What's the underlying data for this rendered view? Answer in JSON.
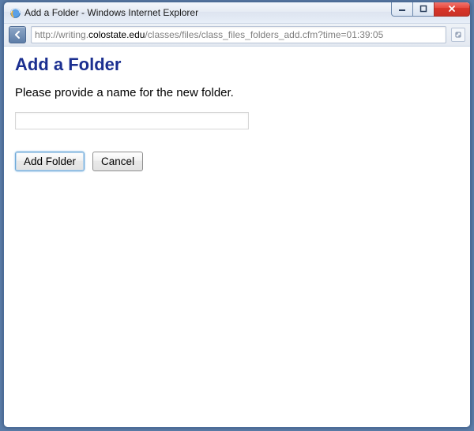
{
  "window": {
    "title": "Add a Folder - Windows Internet Explorer"
  },
  "address": {
    "protocol": "http://",
    "host_pre": "writing.",
    "host_bold": "colostate.edu",
    "path": "/classes/files/class_files_folders_add.cfm?time=01:39:05"
  },
  "page": {
    "heading": "Add a Folder",
    "prompt": "Please provide a name for the new folder.",
    "input_value": "",
    "add_label": "Add Folder",
    "cancel_label": "Cancel"
  }
}
